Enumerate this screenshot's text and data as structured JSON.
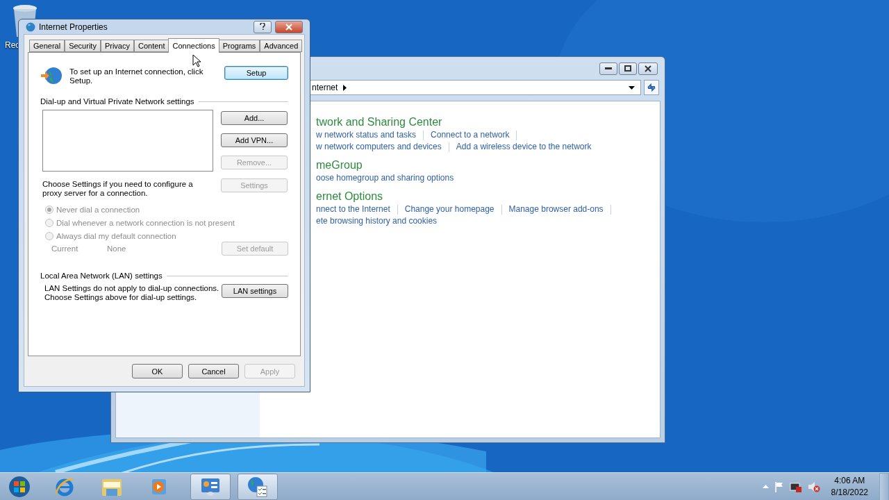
{
  "desktop_icons": [
    {
      "label": "Rec"
    }
  ],
  "control_panel": {
    "address_crumb": "nternet",
    "sections": [
      {
        "title": "twork and Sharing Center",
        "link_rows": [
          {
            "links": [
              "w network status and tasks",
              "Connect to a network"
            ],
            "trailing_separator": true
          },
          {
            "links": [
              "w network computers and devices",
              "Add a wireless device to the network"
            ],
            "trailing_separator": false
          }
        ]
      },
      {
        "title": "meGroup",
        "link_rows": [
          {
            "links": [
              "oose homegroup and sharing options"
            ],
            "trailing_separator": false
          }
        ]
      },
      {
        "title": "ernet Options",
        "link_rows": [
          {
            "links": [
              "nnect to the Internet",
              "Change your homepage",
              "Manage browser add-ons"
            ],
            "trailing_separator": true
          },
          {
            "links": [
              "ete browsing history and cookies"
            ],
            "trailing_separator": false
          }
        ]
      }
    ]
  },
  "dialog": {
    "title": "Internet Properties",
    "tabs": [
      {
        "label": "General",
        "selected": false
      },
      {
        "label": "Security",
        "selected": false
      },
      {
        "label": "Privacy",
        "selected": false
      },
      {
        "label": "Content",
        "selected": false
      },
      {
        "label": "Connections",
        "selected": true
      },
      {
        "label": "Programs",
        "selected": false
      },
      {
        "label": "Advanced",
        "selected": false
      }
    ],
    "setup_text": "To set up an Internet connection, click Setup.",
    "setup_button": "Setup",
    "dialup_heading": "Dial-up and Virtual Private Network settings",
    "side_buttons": [
      {
        "label": "Add...",
        "disabled": false
      },
      {
        "label": "Add VPN...",
        "disabled": false
      },
      {
        "label": "Remove...",
        "disabled": true
      },
      {
        "label": "Settings",
        "disabled": true
      }
    ],
    "proxy_text": "Choose Settings if you need to configure a proxy server for a connection.",
    "dial_options": [
      {
        "label": "Never dial a connection",
        "selected": true,
        "disabled": true
      },
      {
        "label": "Dial whenever a network connection is not present",
        "selected": false,
        "disabled": true
      },
      {
        "label": "Always dial my default connection",
        "selected": false,
        "disabled": true
      }
    ],
    "current_label": "Current",
    "current_value": "None",
    "set_default": {
      "label": "Set default",
      "disabled": true
    },
    "lan_heading": "Local Area Network (LAN) settings",
    "lan_text": "LAN Settings do not apply to dial-up connections.\nChoose Settings above for dial-up settings.",
    "lan_button": "LAN settings",
    "footer_buttons": [
      {
        "label": "OK",
        "disabled": false
      },
      {
        "label": "Cancel",
        "disabled": false
      },
      {
        "label": "Apply",
        "disabled": true
      }
    ]
  },
  "taskbar": {
    "items": [
      {
        "kind": "start",
        "active": false
      },
      {
        "kind": "browser",
        "active": false
      },
      {
        "kind": "folder",
        "active": false
      },
      {
        "kind": "media",
        "active": false
      },
      {
        "kind": "control-panel",
        "active": true
      },
      {
        "kind": "internet-options",
        "active": true
      }
    ],
    "time": "4:06 AM",
    "date": "8/18/2022"
  }
}
